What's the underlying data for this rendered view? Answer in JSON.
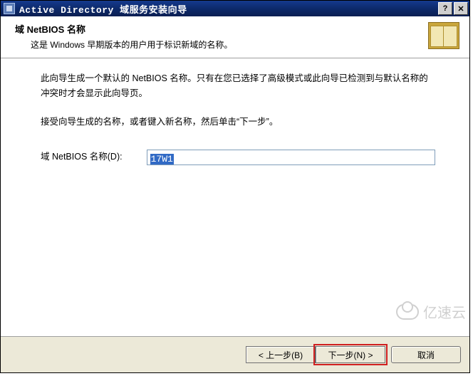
{
  "titlebar": {
    "title": "Active Directory 域服务安装向导"
  },
  "header": {
    "title": "域 NetBIOS 名称",
    "subtitle": "这是 Windows 早期版本的用户用于标识新域的名称。"
  },
  "body": {
    "para1": "此向导生成一个默认的 NetBIOS 名称。只有在您已选择了高级模式或此向导已检测到与默认名称的冲突时才会显示此向导页。",
    "para2": "接受向导生成的名称，或者键入新名称，然后单击“下一步”。",
    "field_label": "域 NetBIOS 名称(D):",
    "field_value": "17W1"
  },
  "footer": {
    "back": "< 上一步(B)",
    "next": "下一步(N) >",
    "cancel": "取消"
  },
  "watermark": {
    "text": "亿速云"
  }
}
